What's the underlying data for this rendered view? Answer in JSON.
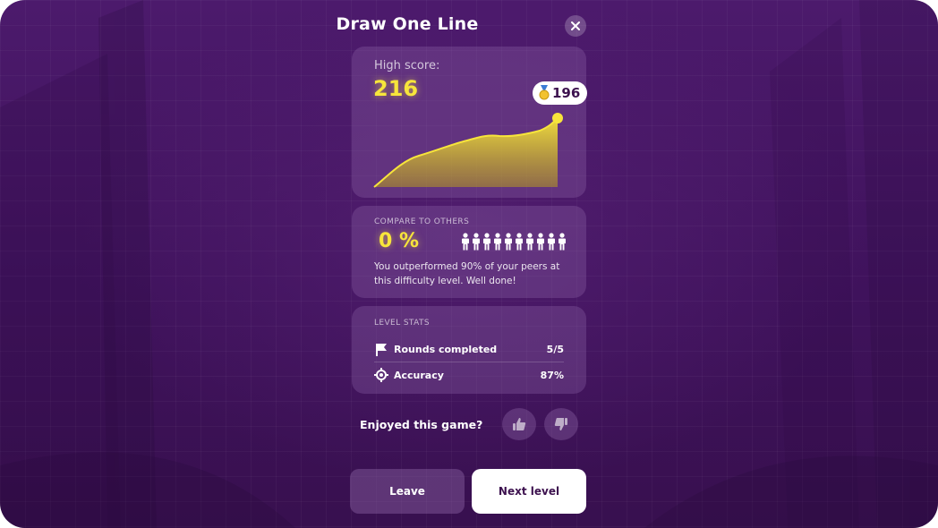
{
  "game": {
    "title": "Draw One Line"
  },
  "high_score": {
    "label": "High score:",
    "value": "216",
    "badge_value": "196",
    "badge_icon": "medal-icon",
    "curve_color": "#f7e53b"
  },
  "compare": {
    "label": "COMPARE TO OTHERS",
    "value": "0 %",
    "people_count": 10,
    "message": "You outperformed 90% of your peers at this difficulty level. Well done!"
  },
  "level_stats": {
    "label": "LEVEL STATS",
    "rows": [
      {
        "icon": "flag-icon",
        "label": "Rounds completed",
        "value": "5/5"
      },
      {
        "icon": "target-icon",
        "label": "Accuracy",
        "value": "87%"
      }
    ]
  },
  "feedback": {
    "question": "Enjoyed this game?"
  },
  "actions": {
    "leave_label": "Leave",
    "next_label": "Next level"
  },
  "colors": {
    "background": "#45165f",
    "accent": "#f7e53b",
    "card": "#6a3f88"
  }
}
